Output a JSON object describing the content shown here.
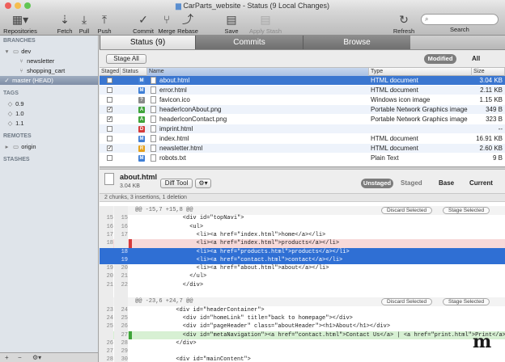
{
  "window": {
    "title": "CarParts_website - Status (9 Local Changes)"
  },
  "toolbar": {
    "repositories": "Repositories",
    "fetch": "Fetch",
    "pull": "Pull",
    "push": "Push",
    "commit": "Commit",
    "merge": "Merge",
    "rebase": "Rebase",
    "save_stash": "Save Stash",
    "apply_stash": "Apply Stash",
    "refresh": "Refresh",
    "search_placeholder": "Search"
  },
  "sidebar": {
    "branches_header": "BRANCHES",
    "branches": [
      "dev",
      "newsletter",
      "shopping_cart",
      "master (HEAD)"
    ],
    "tags_header": "TAGS",
    "tags": [
      "0.9",
      "1.0",
      "1.1"
    ],
    "remotes_header": "REMOTES",
    "remotes": [
      "origin"
    ],
    "stashes_header": "STASHES"
  },
  "tabs": [
    "Status (9)",
    "Commits",
    "Browse"
  ],
  "filebar": {
    "stage_all": "Stage All",
    "modified": "Modified",
    "all": "All"
  },
  "columns": [
    "Staged",
    "Status",
    "Name",
    "Type",
    "Size"
  ],
  "files": [
    {
      "staged": false,
      "status": "M",
      "name": "about.html",
      "type": "HTML document",
      "size": "3.04 KB"
    },
    {
      "staged": false,
      "status": "M",
      "name": "error.html",
      "type": "HTML document",
      "size": "2.11 KB"
    },
    {
      "staged": false,
      "status": "?",
      "name": "favicon.ico",
      "type": "Windows icon image",
      "size": "1.15 KB"
    },
    {
      "staged": true,
      "status": "A",
      "name": "headerIconAbout.png",
      "type": "Portable Network Graphics image",
      "size": "349 B"
    },
    {
      "staged": true,
      "status": "A",
      "name": "headerIconContact.png",
      "type": "Portable Network Graphics image",
      "size": "323 B"
    },
    {
      "staged": false,
      "status": "D",
      "name": "imprint.html",
      "type": "",
      "size": "--"
    },
    {
      "staged": false,
      "status": "M",
      "name": "index.html",
      "type": "HTML document",
      "size": "16.91 KB"
    },
    {
      "staged": true,
      "status": "R",
      "name": "newsletter.html",
      "type": "HTML document",
      "size": "2.60 KB"
    },
    {
      "staged": false,
      "status": "M",
      "name": "robots.txt",
      "type": "Plain Text",
      "size": "9 B"
    }
  ],
  "colors": {
    "M": "#3f7fd6",
    "?": "#8a8a8a",
    "A": "#3fa43a",
    "D": "#d63a3a",
    "R": "#e5a11c",
    "selection": "#3a76d0"
  },
  "diff_header": {
    "file": "about.html",
    "size": "3.04 KB",
    "diff_tool": "Diff Tool",
    "unstaged": "Unstaged",
    "staged": "Staged",
    "base": "Base",
    "current": "Current",
    "summary": "2 chunks, 3 insertions, 1 deletion",
    "discard": "Discard Selected",
    "stage_selected": "Stage Selected"
  },
  "diff_lines": [
    {
      "kind": "hunk",
      "a": "",
      "b": "",
      "text": "@@ -15,7 +15,8 @@"
    },
    {
      "kind": "ctx",
      "a": "15",
      "b": "15",
      "text": "              <div id=\"topNavi\">"
    },
    {
      "kind": "ctx",
      "a": "16",
      "b": "16",
      "text": "                <ul>"
    },
    {
      "kind": "ctx",
      "a": "17",
      "b": "17",
      "text": "                  <li><a href=\"index.html\">home</a></li>"
    },
    {
      "kind": "del",
      "a": "18",
      "b": "",
      "text": "                  <li><a href=\"index.html\">products</a></li>"
    },
    {
      "kind": "sel",
      "a": "",
      "b": "18",
      "text": "                  <li><a href=\"products.html\">products</a></li>"
    },
    {
      "kind": "sel",
      "a": "",
      "b": "19",
      "text": "                  <li><a href=\"contact.html\">contact</a></li>"
    },
    {
      "kind": "ctx",
      "a": "19",
      "b": "20",
      "text": "                  <li><a href=\"about.html\">about</a></li>"
    },
    {
      "kind": "ctx",
      "a": "20",
      "b": "21",
      "text": "                </ul>"
    },
    {
      "kind": "ctx",
      "a": "21",
      "b": "22",
      "text": "              </div>"
    },
    {
      "kind": "blank",
      "a": "",
      "b": "",
      "text": ""
    },
    {
      "kind": "hunk",
      "a": "",
      "b": "",
      "text": "@@ -23,6 +24,7 @@"
    },
    {
      "kind": "ctx",
      "a": "23",
      "b": "24",
      "text": "            <div id=\"headerContainer\">"
    },
    {
      "kind": "ctx",
      "a": "24",
      "b": "25",
      "text": "              <div id=\"homeLink\" title=\"back to homepage\"></div>"
    },
    {
      "kind": "ctx",
      "a": "25",
      "b": "26",
      "text": "              <div id=\"pageHeader\" class=\"aboutHeader\"><h1>About</h1></div>"
    },
    {
      "kind": "add",
      "a": "",
      "b": "27",
      "text": "              <div id=\"metaNavigation\"><a href=\"contact.html\">Contact Us</a> | <a href=\"print.html\">Print</a></div>"
    },
    {
      "kind": "ctx",
      "a": "26",
      "b": "28",
      "text": "            </div>"
    },
    {
      "kind": "blank",
      "a": "27",
      "b": "29",
      "text": ""
    },
    {
      "kind": "ctx",
      "a": "28",
      "b": "30",
      "text": "            <div id=\"mainContent\">"
    }
  ]
}
